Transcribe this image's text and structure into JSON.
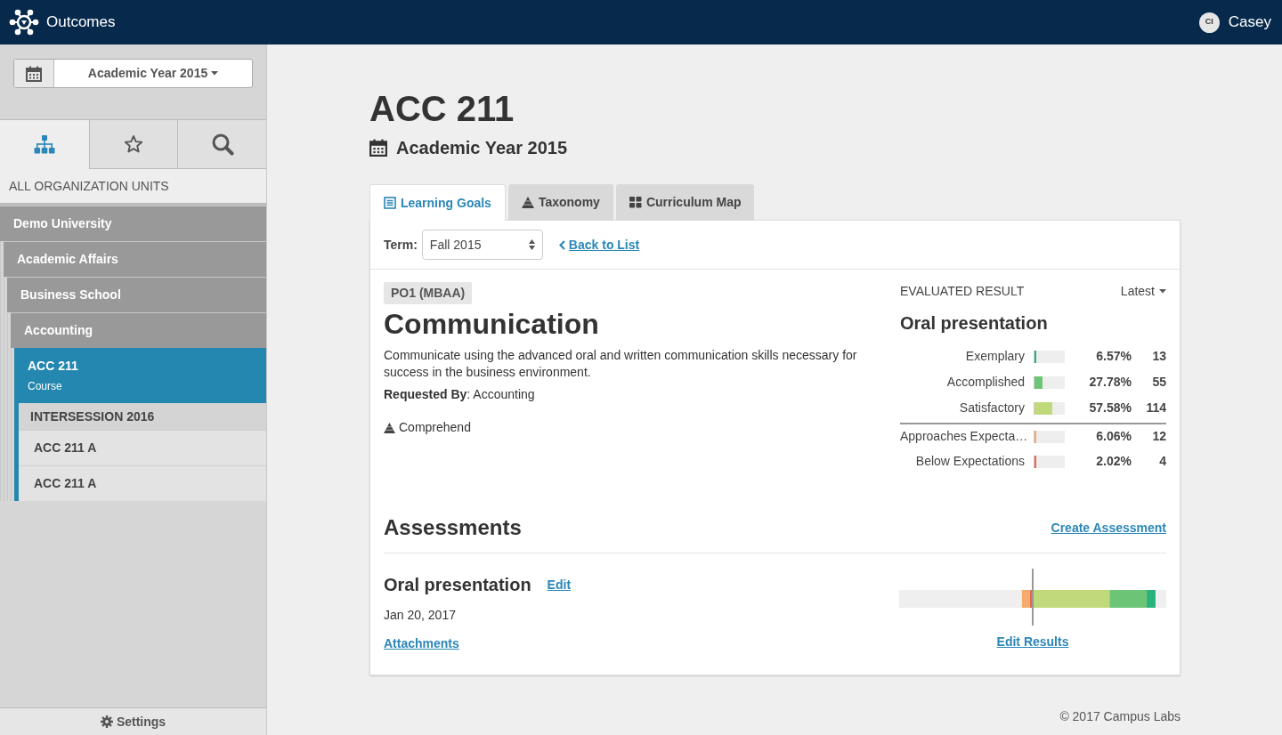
{
  "header": {
    "app_name": "Outcomes",
    "user": {
      "initials": "CI",
      "name": "Casey"
    }
  },
  "sidebar": {
    "year_selector": "Academic Year 2015",
    "nav_tabs": [
      {
        "kind": "hierarchy",
        "selected": true
      },
      {
        "kind": "star",
        "selected": false
      },
      {
        "kind": "search",
        "selected": false
      }
    ],
    "section_label": "ALL ORGANIZATION UNITS",
    "tree": [
      {
        "label": "Demo University",
        "selected": false,
        "children": [
          {
            "label": "Academic Affairs",
            "selected": false,
            "children": [
              {
                "label": "Business School",
                "selected": false,
                "children": [
                  {
                    "label": "Accounting",
                    "selected": false,
                    "children": [
                      {
                        "label": "ACC 211",
                        "sublabel": "Course",
                        "selected": true,
                        "groups": [
                          {
                            "heading": "INTERSESSION 2016",
                            "items": [
                              {
                                "label": "ACC 211 A"
                              },
                              {
                                "label": "ACC 211 A"
                              }
                            ]
                          }
                        ]
                      }
                    ]
                  }
                ]
              }
            ]
          }
        ]
      }
    ],
    "settings": "Settings"
  },
  "page": {
    "title": "ACC 211",
    "subtitle": "Academic Year 2015"
  },
  "tabs": [
    {
      "label": "Learning Goals",
      "kind": "list",
      "selected": true
    },
    {
      "label": "Taxonomy",
      "kind": "pyramid",
      "selected": false
    },
    {
      "label": "Curriculum Map",
      "kind": "grid",
      "selected": false
    }
  ],
  "filter": {
    "term_label": "Term:",
    "term_value": "Fall 2015",
    "back_link": "Back to List"
  },
  "goal": {
    "code": "PO1 (MBAA)",
    "title": "Communication",
    "description": "Communicate using the advanced oral and written communication skills necessary for success in the business environment.",
    "requested_by": "**Requested By**: Accounting",
    "taxonomy": "Comprehend"
  },
  "result": {
    "heading": "EVALUATED RESULT",
    "filter": "Latest",
    "title": "Oral presentation",
    "rows": [
      {
        "label": "Exemplary",
        "kind": "meets",
        "level": 0.0657,
        "percent": "6.57%",
        "count": "13",
        "color": "#2ab27b"
      },
      {
        "label": "Accomplished",
        "kind": "meets",
        "level": 0.2778,
        "percent": "27.78%",
        "count": "55",
        "color": "#6cc576"
      },
      {
        "label": "Satisfactory",
        "kind": "meets",
        "level": 0.5758,
        "percent": "57.58%",
        "count": "114",
        "color": "#c0d97a"
      },
      {
        "label": "Approaches Expecta…",
        "kind": "below",
        "level": 0.0606,
        "percent": "6.06%",
        "count": "12",
        "color": "#f5ab6c"
      },
      {
        "label": "Below Expectations",
        "kind": "below",
        "level": 0.0202,
        "percent": "2.02%",
        "count": "4",
        "color": "#e8674a"
      }
    ]
  },
  "assessments": {
    "title": "Assessments",
    "create_link": "Create Assessment",
    "items": [
      {
        "title": "Oral presentation",
        "edit_link": "Edit",
        "date": "Jan 20, 2017",
        "attachments_link": "Attachments",
        "edit_results_link": "Edit Results"
      }
    ]
  },
  "footer": "© 2017 Campus Labs"
}
